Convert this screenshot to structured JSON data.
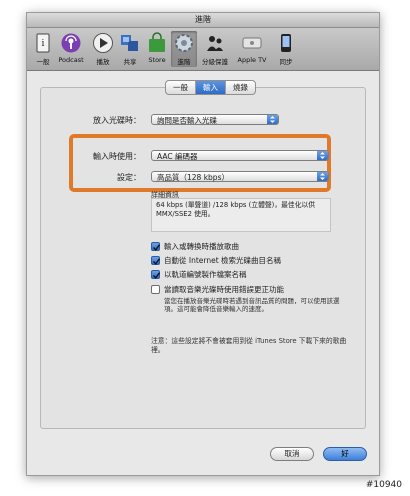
{
  "window": {
    "title": "進階"
  },
  "toolbar": {
    "items": [
      {
        "label": "一般",
        "icon": "general-icon"
      },
      {
        "label": "Podcast",
        "icon": "podcast-icon"
      },
      {
        "label": "播放",
        "icon": "playback-icon"
      },
      {
        "label": "共享",
        "icon": "sharing-icon"
      },
      {
        "label": "Store",
        "icon": "store-icon"
      },
      {
        "label": "進階",
        "icon": "advanced-gear-icon"
      },
      {
        "label": "分級保護",
        "icon": "parental-icon"
      },
      {
        "label": "Apple TV",
        "icon": "apple-tv-icon"
      },
      {
        "label": "同步",
        "icon": "sync-icon"
      }
    ]
  },
  "tabs": [
    "一般",
    "輸入",
    "燒錄"
  ],
  "form": {
    "insert_cd_label": "放入光碟時：",
    "insert_cd_value": "詢問是否輸入光碟",
    "import_using_label": "輸入時使用：",
    "import_using_value": "AAC 編碼器",
    "setting_label": "設定：",
    "setting_value": "高品質（128 kbps）",
    "details_title": "詳細資訊",
    "details_text": "64 kbps (單聲道) /128 kbps (立體聲)，最佳化以供 MMX/SSE2 使用。"
  },
  "checkboxes": [
    {
      "label": "輸入或轉換時播放歌曲",
      "checked": true
    },
    {
      "label": "自動從 Internet 檢索光碟曲目名稱",
      "checked": true
    },
    {
      "label": "以軌道編號製作檔案名稱",
      "checked": true
    },
    {
      "label": "當讀取音樂光碟時使用錯誤更正功能",
      "checked": false
    }
  ],
  "error_correction_note": "當您在播放音樂光碟時若遇到音訊品質的問題，可以使用該選項。這可能會降低音樂輸入的速度。",
  "footer_note": "注意：這些設定將不會被套用到從 iTunes Store 下載下來的歌曲裡。",
  "buttons": {
    "cancel": "取消",
    "ok": "好"
  },
  "watermark": "#10940",
  "colors": {
    "accent": "#2f6ecb",
    "highlight_box": "#e07a2a"
  }
}
